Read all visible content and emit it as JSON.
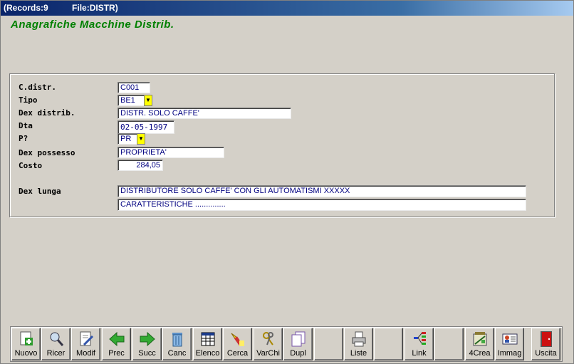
{
  "window": {
    "title_records": "(Records:9",
    "title_file": "File:DISTR)"
  },
  "form": {
    "title": "Anagrafiche Macchine Distrib."
  },
  "fields": {
    "cdistr": {
      "label": "C.distr.",
      "value": "C001"
    },
    "tipo": {
      "label": "Tipo",
      "value": "BE1"
    },
    "dex_distrib": {
      "label": "Dex distrib.",
      "value": "DISTR. SOLO CAFFE'"
    },
    "dta": {
      "label": "Dta",
      "value": "02-05-1997"
    },
    "p": {
      "label": "P?",
      "value": "PR"
    },
    "dex_possesso": {
      "label": "Dex possesso",
      "value": "PROPRIETA'"
    },
    "costo": {
      "label": "Costo",
      "value": "284,05"
    },
    "dex_lunga": {
      "label": "Dex lunga",
      "value1": "DISTRIBUTORE SOLO CAFFE' CON GLI AUTOMATISMI  XXXXX",
      "value2": "CARATTERISTICHE .............."
    }
  },
  "toolbar": {
    "nuovo": "Nuovo",
    "ricer": "Ricer",
    "modif": "Modif",
    "prec": "Prec",
    "succ": "Succ",
    "canc": "Canc",
    "elenco": "Elenco",
    "cerca": "Cerca",
    "varchi": "VarChi",
    "dupl": "Dupl",
    "liste": "Liste",
    "link": "Link",
    "crea4": "4Crea",
    "immag": "Immag",
    "uscita": "Uscita"
  },
  "colors": {
    "title_green": "#008000",
    "field_text": "#000080",
    "dropdown_yellow": "#ffff00"
  }
}
